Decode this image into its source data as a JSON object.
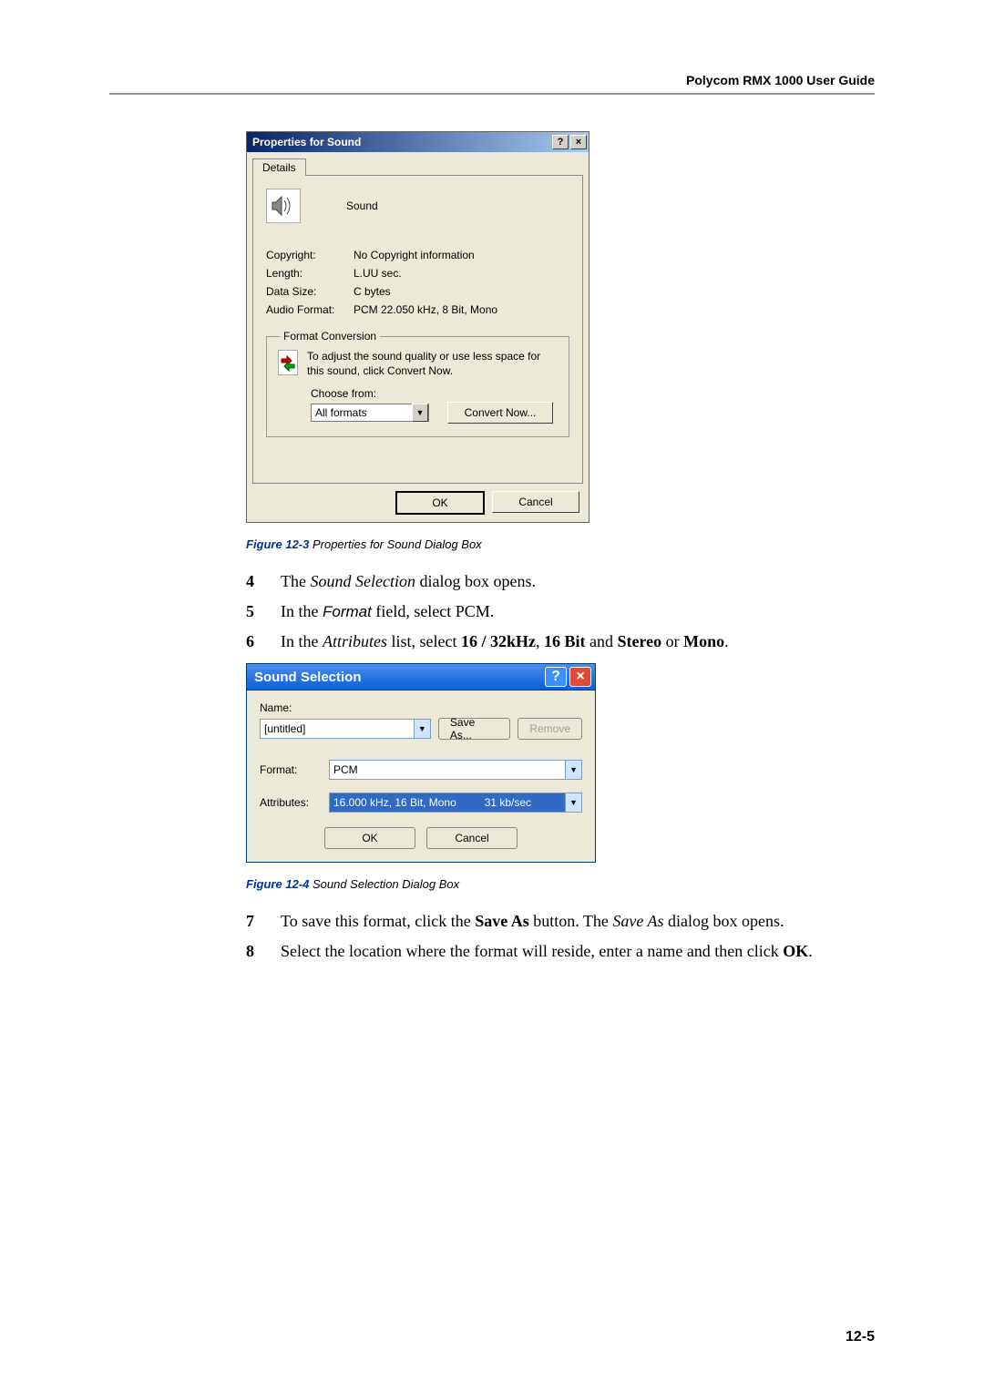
{
  "header": "Polycom RMX 1000 User Guide",
  "props_dialog": {
    "title": "Properties for Sound",
    "tab": "Details",
    "sound_label": "Sound",
    "rows": {
      "copyright_label": "Copyright:",
      "copyright_value": "No Copyright information",
      "length_label": "Length:",
      "length_value": "L.UU sec.",
      "size_label": "Data Size:",
      "size_value": "C bytes",
      "format_label": "Audio Format:",
      "format_value": "PCM 22.050 kHz, 8 Bit, Mono"
    },
    "fc": {
      "legend": "Format Conversion",
      "text": "To adjust the sound quality or use less space for this sound, click Convert Now.",
      "choose_label": "Choose from:",
      "choose_value": "All formats",
      "convert_btn": "Convert Now..."
    },
    "ok": "OK",
    "cancel": "Cancel"
  },
  "caption1_fig": "Figure 12-3",
  "caption1_txt": " Properties for Sound Dialog Box",
  "steps_before": {
    "s4": "The Sound Selection dialog box opens.",
    "s5_pre": "In the ",
    "s5_field": "Format",
    "s5_post": " field, select PCM.",
    "s6_pre": "In the ",
    "s6_attr": "Attributes",
    "s6_mid": " list, select ",
    "s6_v1": "16 / 32kHz",
    "s6_c1": ", ",
    "s6_v2": "16 Bit",
    "s6_c2": " and ",
    "s6_v3": "Stereo",
    "s6_c3": " or ",
    "s6_v4": "Mono",
    "s6_end": "."
  },
  "ss_dialog": {
    "title": "Sound Selection",
    "name_label": "Name:",
    "name_value": "[untitled]",
    "save_as": "Save As...",
    "remove": "Remove",
    "format_label": "Format:",
    "format_value": "PCM",
    "attr_label": "Attributes:",
    "attr_value": "16.000 kHz, 16 Bit, Mono",
    "attr_rate": "31 kb/sec",
    "ok": "OK",
    "cancel": "Cancel"
  },
  "caption2_fig": "Figure 12-4",
  "caption2_txt": " Sound Selection Dialog Box",
  "steps_after": {
    "s7_pre": "To save this format, click the ",
    "s7_b": "Save As",
    "s7_mid": " button. The ",
    "s7_i": "Save As",
    "s7_post": " dialog box opens.",
    "s8_pre": "Select the location where the format will reside, enter a name and then click ",
    "s8_b": "OK",
    "s8_end": "."
  },
  "page_num": "12-5"
}
